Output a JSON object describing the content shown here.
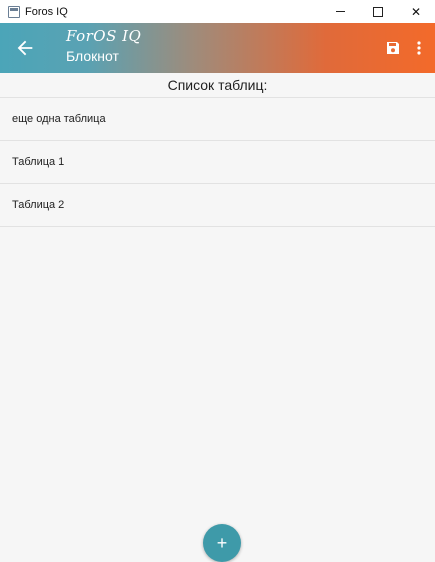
{
  "window": {
    "title": "Foros IQ",
    "controls": {
      "minimize": "–",
      "maximize": "□",
      "close": "✕"
    }
  },
  "header": {
    "logo": "ForOS IQ",
    "title": "Блокнот",
    "icons": {
      "back": "arrow-back-icon",
      "save": "save-icon",
      "more": "more-vert-icon"
    },
    "colors": {
      "gradient_start": "#4ba5b8",
      "gradient_end": "#f36a2a"
    }
  },
  "list": {
    "heading": "Список таблиц:",
    "items": [
      {
        "label": "еще одна таблица"
      },
      {
        "label": "Таблица 1"
      },
      {
        "label": "Таблица 2"
      }
    ]
  },
  "fab": {
    "label": "+",
    "color": "#3e9aa9"
  }
}
